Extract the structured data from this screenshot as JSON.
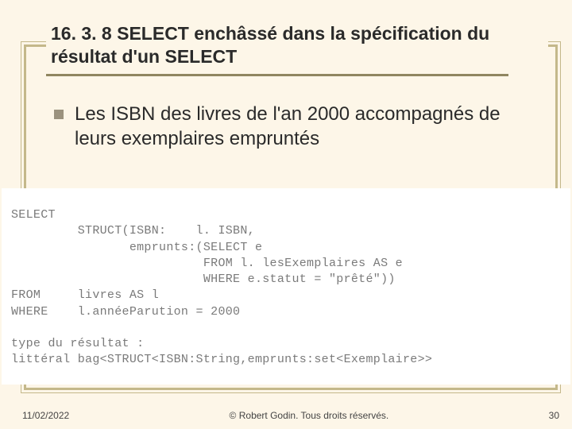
{
  "title": "16. 3. 8 SELECT enchâssé dans la spécification du résultat d'un SELECT",
  "bullet": "Les ISBN des livres de l'an 2000 accompagnés de leurs exemplaires empruntés",
  "code": "SELECT\n         STRUCT(ISBN:    l. ISBN,\n                emprunts:(SELECT e\n                          FROM l. lesExemplaires AS e\n                          WHERE e.statut = \"prêté\"))\nFROM     livres AS l\nWHERE    l.annéeParution = 2000\n\ntype du résultat :\nlittéral bag<STRUCT<ISBN:String,emprunts:set<Exemplaire>>",
  "footer": {
    "date": "11/02/2022",
    "copyright": "© Robert Godin. Tous droits réservés.",
    "page": "30"
  }
}
